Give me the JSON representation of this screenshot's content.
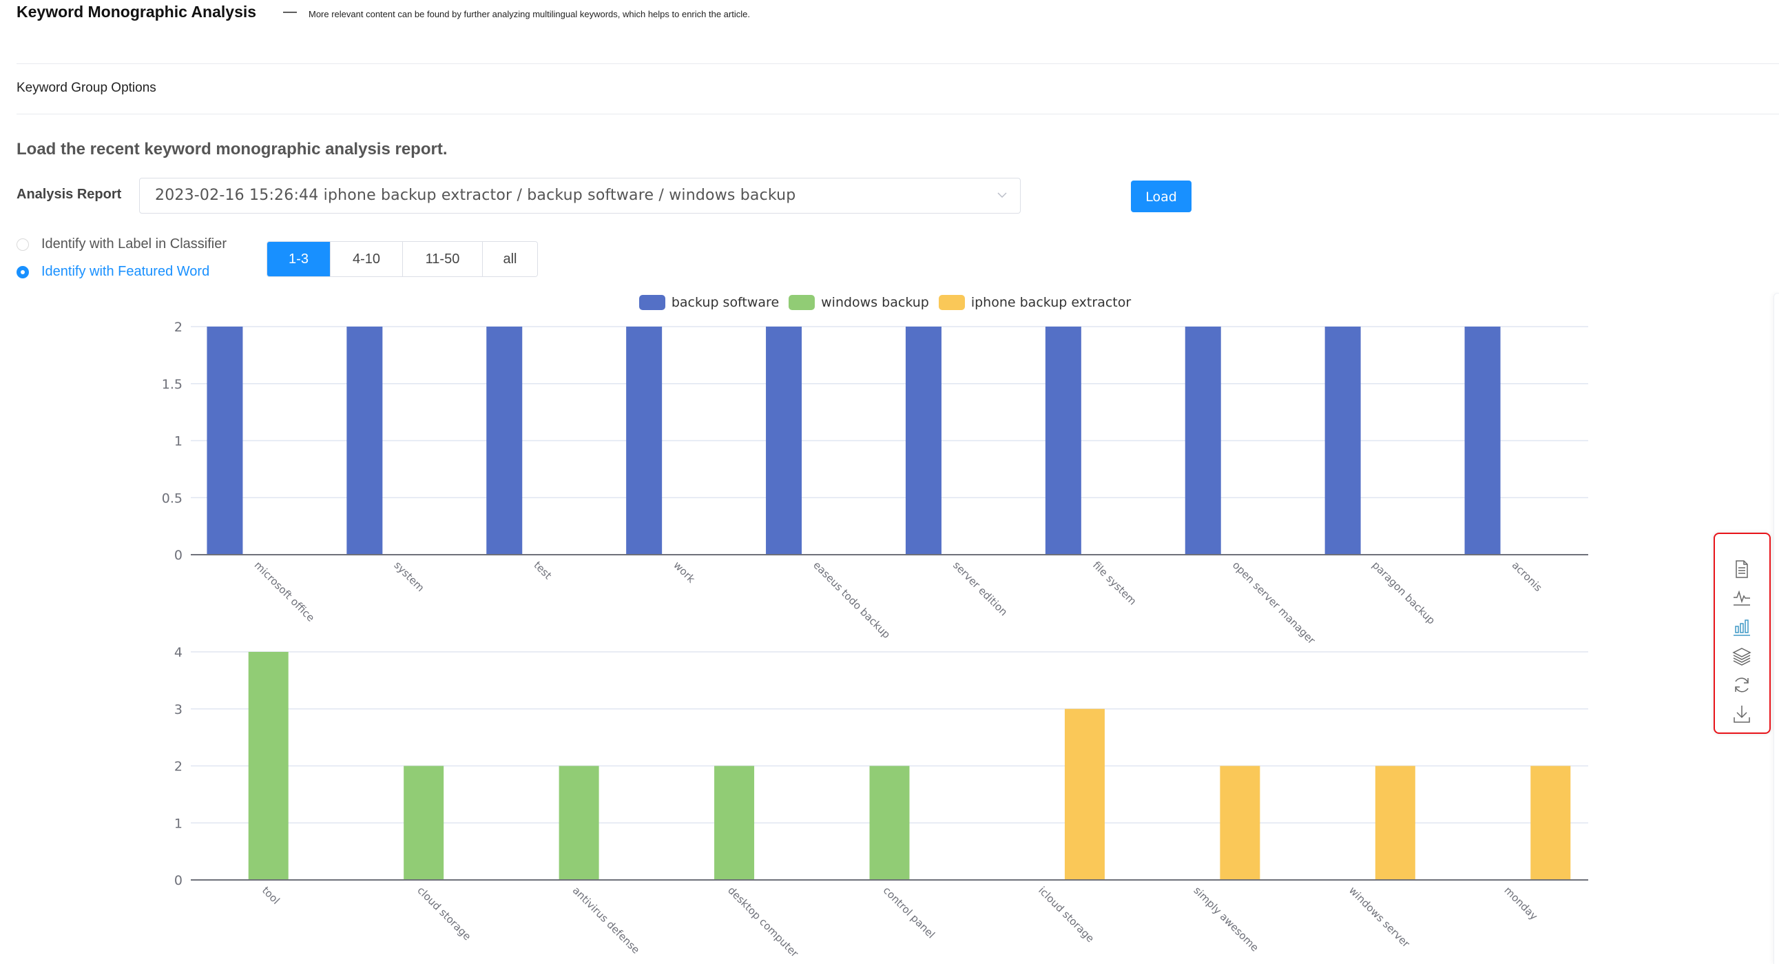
{
  "header": {
    "title": "Keyword Monographic Analysis",
    "dash": "—",
    "subtitle": "More relevant content can be found by further analyzing multilingual keywords, which helps to enrich the article."
  },
  "keyword_group_options_label": "Keyword Group Options",
  "section": {
    "heading": "Load the recent keyword monographic analysis report.",
    "analysis_report_label": "Analysis Report",
    "analysis_report_value": "2023-02-16 15:26:44 iphone backup extractor / backup software / windows backup",
    "load_button": "Load"
  },
  "identify_options": [
    {
      "label": "Identify with Label in Classifier",
      "checked": false
    },
    {
      "label": "Identify with Featured Word",
      "checked": true
    }
  ],
  "range_segments": [
    {
      "label": "1-3",
      "active": true
    },
    {
      "label": "4-10",
      "active": false
    },
    {
      "label": "11-50",
      "active": false
    },
    {
      "label": "all",
      "active": false
    }
  ],
  "colors": {
    "accent": "#1890ff",
    "backup_software": "#5470c6",
    "windows_backup": "#91cc75",
    "iphone_backup_extractor": "#fac858",
    "toolbox_highlight": "#e8141a"
  },
  "toolbox": [
    {
      "name": "data-view-icon",
      "active": false
    },
    {
      "name": "line-chart-icon",
      "active": false
    },
    {
      "name": "bar-chart-icon",
      "active": true
    },
    {
      "name": "stack-icon",
      "active": false
    },
    {
      "name": "restore-icon",
      "active": false
    },
    {
      "name": "save-image-icon",
      "active": false
    }
  ],
  "chart_data": [
    {
      "type": "bar",
      "title": "",
      "legend": [
        "backup software",
        "windows backup",
        "iphone backup extractor"
      ],
      "legend_position": "top-center",
      "categories": [
        "microsoft office",
        "system",
        "test",
        "work",
        "easeus todo backup",
        "server edition",
        "file system",
        "open server manager",
        "paragon backup",
        "acronis"
      ],
      "series": [
        {
          "name": "backup software",
          "values": [
            2,
            2,
            2,
            2,
            2,
            2,
            2,
            2,
            2,
            2
          ]
        },
        {
          "name": "windows backup",
          "values": [
            null,
            null,
            null,
            null,
            null,
            null,
            null,
            null,
            null,
            null
          ]
        },
        {
          "name": "iphone backup extractor",
          "values": [
            null,
            null,
            null,
            null,
            null,
            null,
            null,
            null,
            null,
            null
          ]
        }
      ],
      "yticks": [
        "0",
        "0.5",
        "1",
        "1.5",
        "2"
      ],
      "ylim": [
        0,
        2
      ],
      "xlabel": "",
      "ylabel": "",
      "grid": true
    },
    {
      "type": "bar",
      "title": "",
      "categories": [
        "tool",
        "cloud storage",
        "antivirus defense",
        "desktop computer",
        "control panel",
        "icloud storage",
        "simply awesome",
        "windows server",
        "monday"
      ],
      "series": [
        {
          "name": "backup software",
          "values": [
            null,
            null,
            null,
            null,
            null,
            null,
            null,
            null,
            null
          ]
        },
        {
          "name": "windows backup",
          "values": [
            4,
            2,
            2,
            2,
            2,
            null,
            null,
            null,
            null
          ]
        },
        {
          "name": "iphone backup extractor",
          "values": [
            null,
            null,
            null,
            null,
            null,
            3,
            2,
            2,
            2
          ]
        }
      ],
      "yticks": [
        "0",
        "1",
        "2",
        "3",
        "4"
      ],
      "ylim": [
        0,
        4
      ],
      "xlabel": "",
      "ylabel": "",
      "grid": true
    }
  ]
}
